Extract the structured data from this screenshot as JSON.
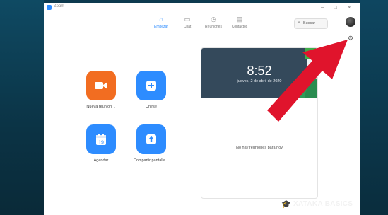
{
  "window": {
    "app_name": "Zoom"
  },
  "nav": {
    "tabs": [
      {
        "label": "Empezar",
        "icon": "home-icon",
        "active": true
      },
      {
        "label": "Chat",
        "icon": "chat-icon",
        "active": false
      },
      {
        "label": "Reuniones",
        "icon": "clock-icon",
        "active": false
      },
      {
        "label": "Contactos",
        "icon": "contacts-icon",
        "active": false
      }
    ],
    "search_placeholder": "Buscar"
  },
  "actions": [
    {
      "label": "Nueva reunión",
      "color": "#f26d21",
      "icon": "video-camera-icon",
      "has_dropdown": true
    },
    {
      "label": "Unirse",
      "color": "#2d8cff",
      "icon": "plus-icon",
      "has_dropdown": false
    },
    {
      "label": "Agendar",
      "color": "#2d8cff",
      "icon": "calendar-icon",
      "has_dropdown": false,
      "icon_text": "19"
    },
    {
      "label": "Compartir pantalla",
      "color": "#2d8cff",
      "icon": "share-screen-icon",
      "has_dropdown": true
    }
  ],
  "meeting_card": {
    "time": "8:52",
    "date": "jueves, 2 de abril de 2020",
    "empty_text": "No hay reuniones para hoy"
  },
  "watermark": {
    "text": "XATAKA BASICS"
  },
  "colors": {
    "accent": "#2d8cff",
    "orange": "#f26d21",
    "arrow": "#e0142c",
    "hero": "#34495b"
  }
}
